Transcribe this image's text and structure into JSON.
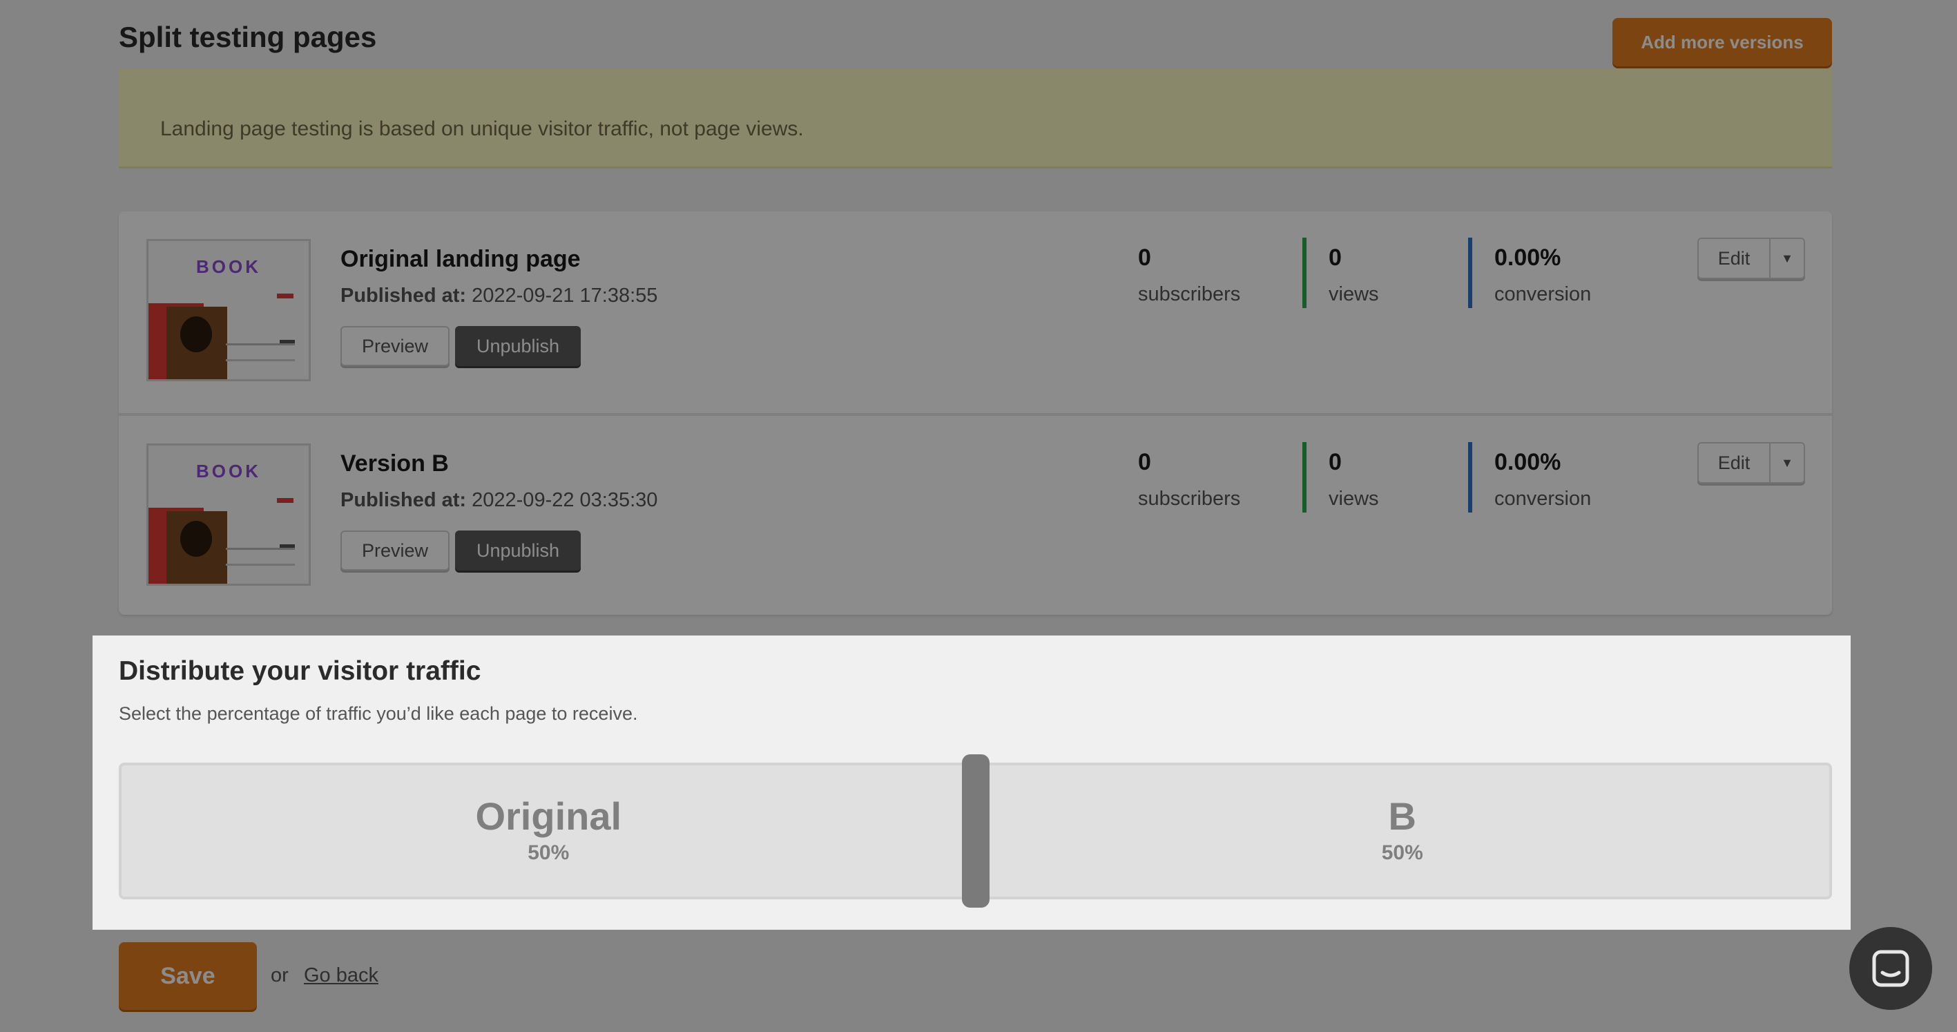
{
  "page": {
    "title": "Split testing pages",
    "add_versions_label": "Add more versions",
    "notice": "Landing page testing is based on unique visitor traffic, not page views."
  },
  "versions": [
    {
      "name": "Original landing page",
      "published_label": "Published at:",
      "published_at": "2022-09-21 17:38:55",
      "preview_label": "Preview",
      "unpublish_label": "Unpublish",
      "subscribers": "0",
      "subscribers_label": "subscribers",
      "views": "0",
      "views_label": "views",
      "conversion": "0.00%",
      "conversion_label": "conversion",
      "edit_label": "Edit",
      "thumb_logo": "BOOK"
    },
    {
      "name": "Version B",
      "published_label": "Published at:",
      "published_at": "2022-09-22 03:35:30",
      "preview_label": "Preview",
      "unpublish_label": "Unpublish",
      "subscribers": "0",
      "subscribers_label": "subscribers",
      "views": "0",
      "views_label": "views",
      "conversion": "0.00%",
      "conversion_label": "conversion",
      "edit_label": "Edit",
      "thumb_logo": "BOOK"
    }
  ],
  "distribution": {
    "title": "Distribute your visitor traffic",
    "subtitle": "Select the percentage of traffic you’d like each page to receive.",
    "original_name": "Original",
    "original_pct": "50%",
    "b_name": "B",
    "b_pct": "50%",
    "split_fraction": 0.5
  },
  "footer": {
    "save_label": "Save",
    "or_text": "or",
    "go_back_label": "Go back"
  },
  "colors": {
    "accent": "#e07d1f",
    "subscribers_bar": "#2fa84f",
    "views_bar": "#2f73c9"
  },
  "icons": {
    "edit_menu": "caret-down-icon",
    "chat": "chat-bubble-icon"
  }
}
